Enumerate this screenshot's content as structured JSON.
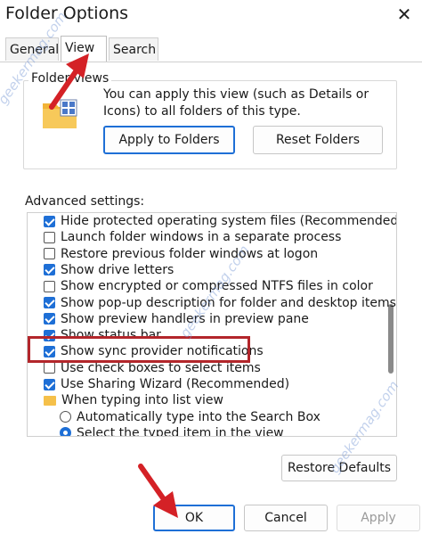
{
  "window": {
    "title": "Folder Options",
    "close_glyph": "✕"
  },
  "tabs": [
    {
      "label": "General",
      "active": false
    },
    {
      "label": "View",
      "active": true
    },
    {
      "label": "Search",
      "active": false
    }
  ],
  "folder_views": {
    "title": "Folder views",
    "description": "You can apply this view (such as Details or Icons) to all folders of this type.",
    "apply_button": "Apply to Folders",
    "reset_button": "Reset Folders"
  },
  "advanced": {
    "label": "Advanced settings:",
    "items": [
      {
        "type": "checkbox",
        "checked": true,
        "label": "Hide protected operating system files (Recommended)"
      },
      {
        "type": "checkbox",
        "checked": false,
        "label": "Launch folder windows in a separate process"
      },
      {
        "type": "checkbox",
        "checked": false,
        "label": "Restore previous folder windows at logon"
      },
      {
        "type": "checkbox",
        "checked": true,
        "label": "Show drive letters"
      },
      {
        "type": "checkbox",
        "checked": false,
        "label": "Show encrypted or compressed NTFS files in color"
      },
      {
        "type": "checkbox",
        "checked": true,
        "label": "Show pop-up description for folder and desktop items"
      },
      {
        "type": "checkbox",
        "checked": true,
        "label": "Show preview handlers in preview pane"
      },
      {
        "type": "checkbox",
        "checked": true,
        "label": "Show status bar"
      },
      {
        "type": "checkbox",
        "checked": true,
        "label": "Show sync provider notifications"
      },
      {
        "type": "checkbox",
        "checked": false,
        "label": "Use check boxes to select items"
      },
      {
        "type": "checkbox",
        "checked": true,
        "label": "Use Sharing Wizard (Recommended)"
      },
      {
        "type": "folder",
        "label": "When typing into list view"
      },
      {
        "type": "radio",
        "checked": false,
        "label": "Automatically type into the Search Box"
      },
      {
        "type": "radio",
        "checked": true,
        "label": "Select the typed item in the view"
      }
    ],
    "restore_button": "Restore Defaults"
  },
  "footer": {
    "ok": "OK",
    "cancel": "Cancel",
    "apply": "Apply"
  },
  "watermark": "geekermag.com",
  "colors": {
    "accent": "#1e6fd6",
    "highlight": "#b3262b",
    "arrow": "#d42126"
  }
}
